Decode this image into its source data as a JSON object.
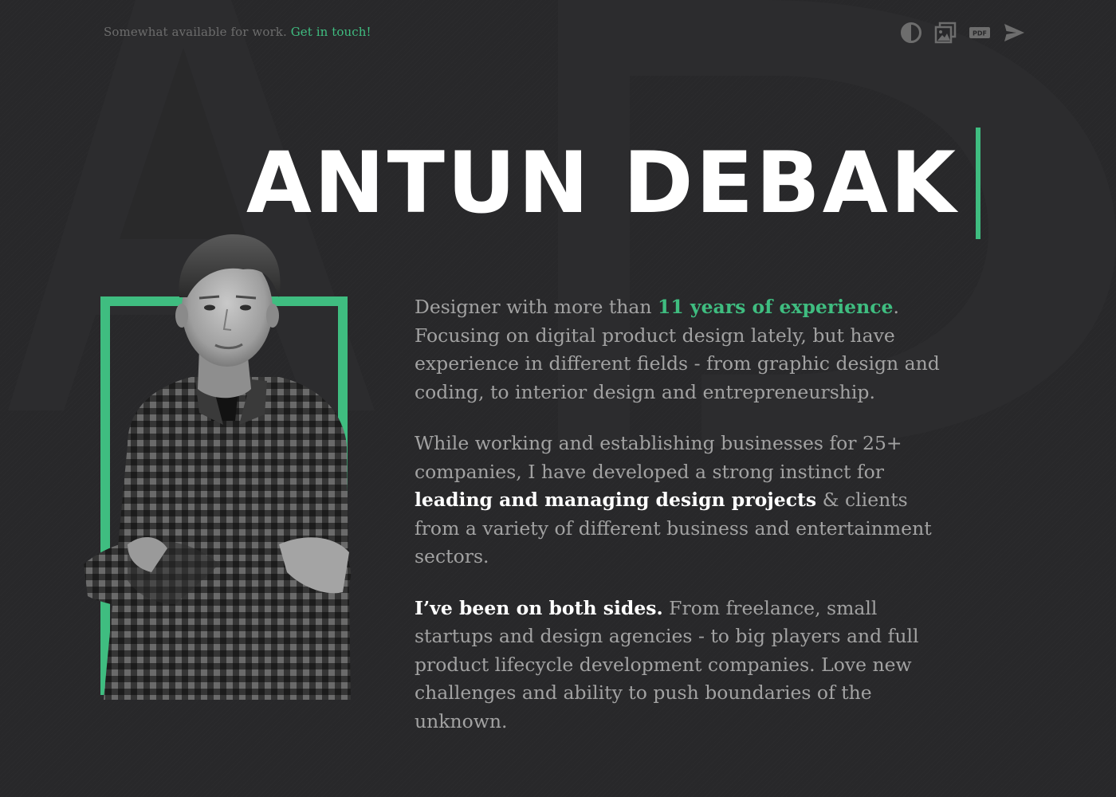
{
  "header": {
    "availability_text": "Somewhat available for work.",
    "contact_link": "Get in touch!"
  },
  "toolbar": {
    "icons": [
      "contrast-icon",
      "image-icon",
      "pdf-icon",
      "send-icon"
    ],
    "pdf_label": "PDF"
  },
  "hero": {
    "name": "ANTUN DEBAK"
  },
  "bio": {
    "p1": {
      "before": "Designer with more than ",
      "highlight": "11 years of experience",
      "after": ". Focusing on digital product design lately, but have experience in different fields - from graphic design and coding, to interior design and entrepreneurship."
    },
    "p2": {
      "before": "While working and establishing businesses for 25+ companies, I have developed a strong instinct for ",
      "strong": "leading and managing design projects",
      "after": " & clients from a variety of different business and entertainment sectors."
    },
    "p3": {
      "strong": "I’ve been on both sides.",
      "after": " From freelance, small startups and design agencies - to big players and full product lifecycle development companies. Love new challenges and ability to push boundaries of the unknown."
    }
  },
  "colors": {
    "background": "#28282a",
    "accent": "#3fbd80",
    "heading": "#ffffff",
    "body_text": "#a2a2a2",
    "muted": "#6c6c6c"
  }
}
